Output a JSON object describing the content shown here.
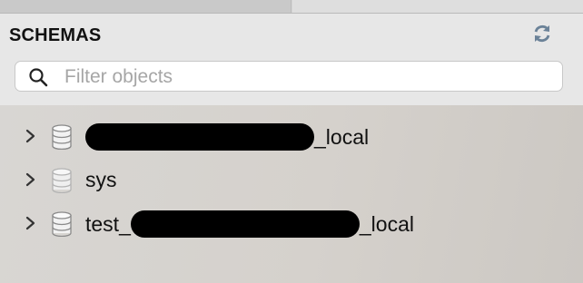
{
  "panel": {
    "title": "SCHEMAS",
    "refresh_icon": "refresh-icon"
  },
  "search": {
    "placeholder": "Filter objects",
    "value": "",
    "icon": "search-icon"
  },
  "schemas": [
    {
      "prefix": "",
      "suffix": "_local",
      "redacted": true,
      "icon": "database-icon",
      "dimmed": false
    },
    {
      "prefix": "sys",
      "suffix": "",
      "redacted": false,
      "icon": "database-icon",
      "dimmed": true
    },
    {
      "prefix": "test_",
      "suffix": "_local",
      "redacted": true,
      "icon": "database-icon",
      "dimmed": false
    }
  ],
  "colors": {
    "header_bg": "#e7e7e7",
    "tree_bg": "#d6d3cf",
    "text": "#111111",
    "placeholder": "#a6a6a6",
    "redaction": "#000000"
  }
}
